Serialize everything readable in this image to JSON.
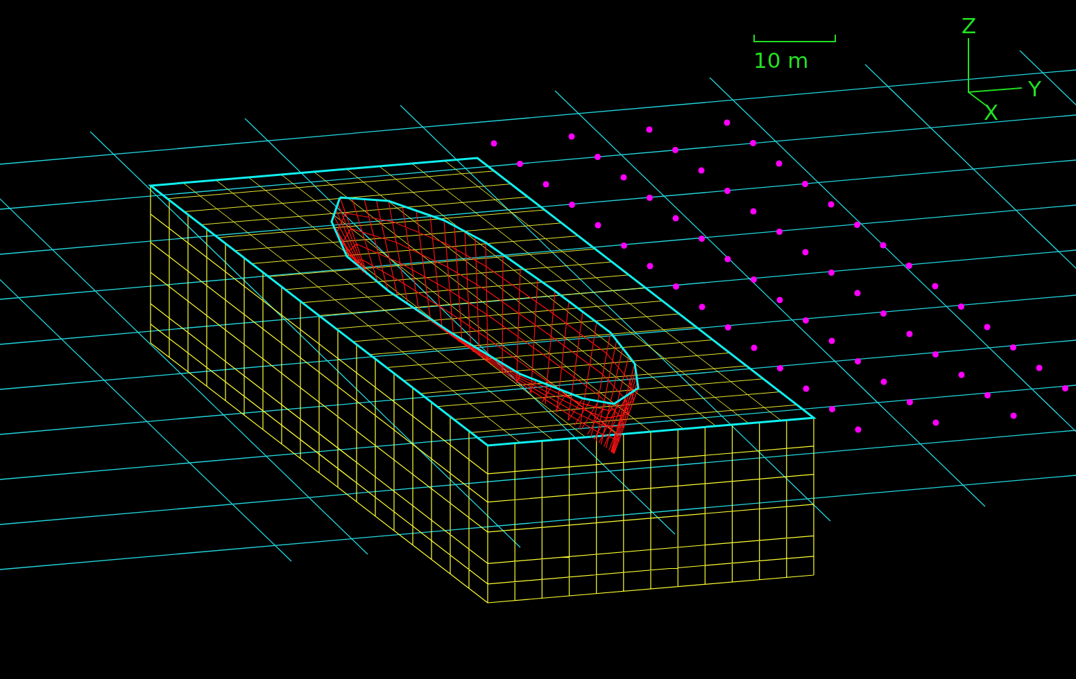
{
  "scale_bar": {
    "label": "10 m"
  },
  "axes": {
    "z": "Z",
    "y": "Y",
    "x": "X"
  }
}
